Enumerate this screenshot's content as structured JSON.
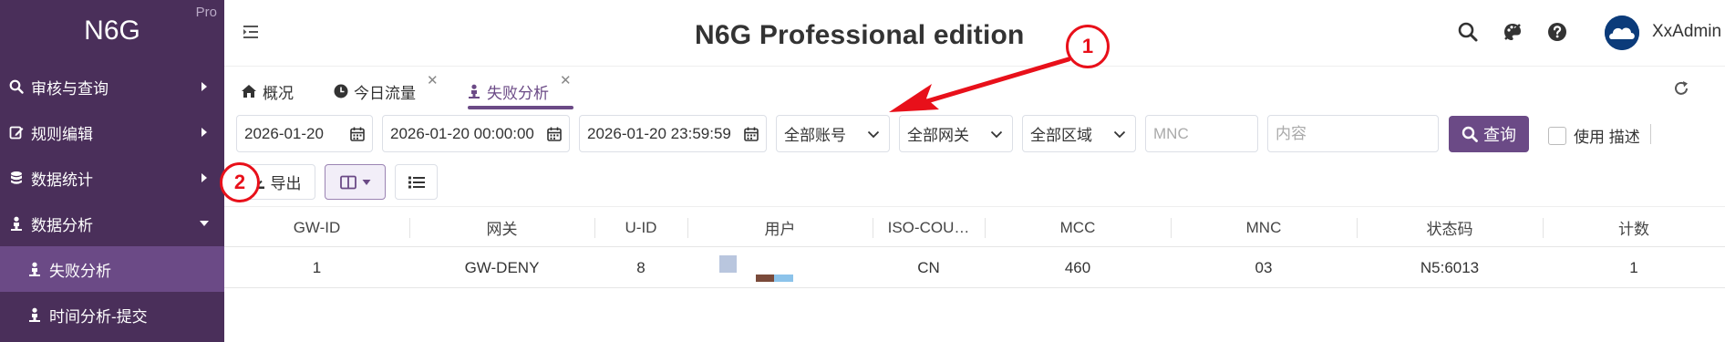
{
  "brand": {
    "name": "N6G",
    "tag": "Pro"
  },
  "sidebar": {
    "items": [
      {
        "label": "审核与查询",
        "icon": "search-icon",
        "caret": "right"
      },
      {
        "label": "规则编辑",
        "icon": "edit-icon",
        "caret": "right"
      },
      {
        "label": "数据统计",
        "icon": "database-icon",
        "caret": "right"
      },
      {
        "label": "数据分析",
        "icon": "person-icon",
        "caret": "down"
      },
      {
        "label": "失败分析",
        "icon": "person-icon",
        "active": true
      },
      {
        "label": "时间分析-提交",
        "icon": "person-icon"
      }
    ]
  },
  "header": {
    "title": "N6G Professional edition",
    "user": "XxAdmin"
  },
  "tabs": [
    {
      "label": "概况",
      "icon": "home-icon",
      "closable": false
    },
    {
      "label": "今日流量",
      "icon": "clock-icon",
      "closable": true
    },
    {
      "label": "失败分析",
      "icon": "person-icon",
      "closable": true,
      "active": true
    }
  ],
  "filters": {
    "date": "2026-01-20",
    "start_time": "2026-01-20 00:00:00",
    "end_time": "2026-01-20 23:59:59",
    "account": "全部账号",
    "gateway": "全部网关",
    "region": "全部区域",
    "mnc_placeholder": "MNC",
    "content_placeholder": "内容",
    "query_label": "查询",
    "checkbox_label": "使用 描述"
  },
  "toolbar": {
    "export_label": "导出"
  },
  "table": {
    "columns": [
      "GW-ID",
      "网关",
      "U-ID",
      "用户",
      "ISO-COU…",
      "MCC",
      "MNC",
      "状态码",
      "计数"
    ],
    "rows": [
      [
        "1",
        "GW-DENY",
        "8",
        "",
        "CN",
        "460",
        "03",
        "N5:6013",
        "1"
      ]
    ]
  },
  "annotations": {
    "marker1": "1",
    "marker2": "2"
  },
  "colors": {
    "sidebar_bg": "#4a2f5a",
    "accent": "#6b4a86",
    "annotation": "#e8101a"
  }
}
